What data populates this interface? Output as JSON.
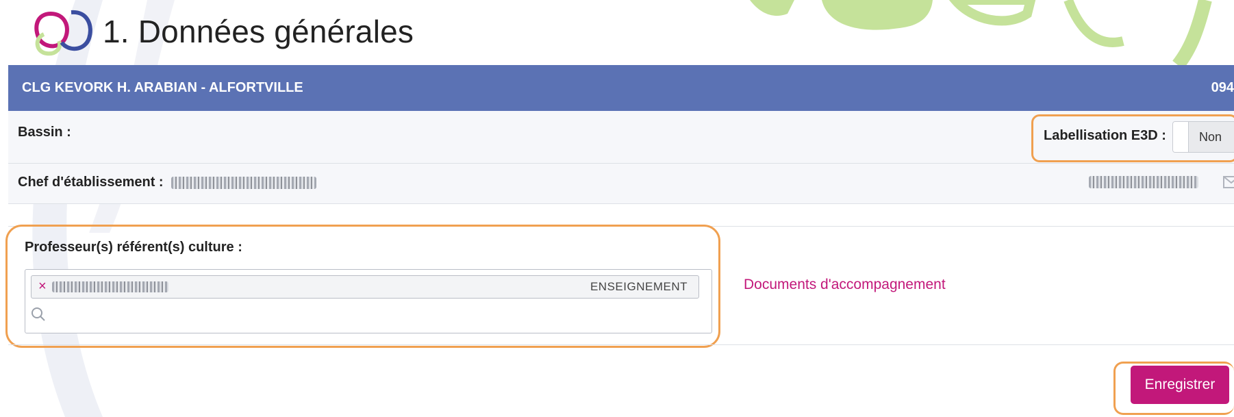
{
  "page": {
    "title": "1. Données générales"
  },
  "school": {
    "name": "CLG KEVORK H. ARABIAN - ALFORTVILLE",
    "code": "094"
  },
  "bassin": {
    "label": "Bassin :"
  },
  "e3d": {
    "label": "Labellisation E3D :",
    "toggle_value": "Non"
  },
  "chef": {
    "label": "Chef d'établissement :"
  },
  "referent": {
    "label": "Professeur(s) référent(s) culture :",
    "tags": [
      {
        "remove_symbol": "×",
        "role": "ENSEIGNEMENT"
      }
    ],
    "search_placeholder": ""
  },
  "links": {
    "documents": "Documents d'accompagnement"
  },
  "actions": {
    "save_label": "Enregistrer"
  },
  "colors": {
    "header_bar": "#5b72b4",
    "accent_magenta": "#c2187a",
    "highlight_orange": "#f0a050",
    "decor_green": "#c5e29a"
  },
  "icons": [
    "logo-icon",
    "mail-icon",
    "search-icon",
    "remove-icon"
  ]
}
